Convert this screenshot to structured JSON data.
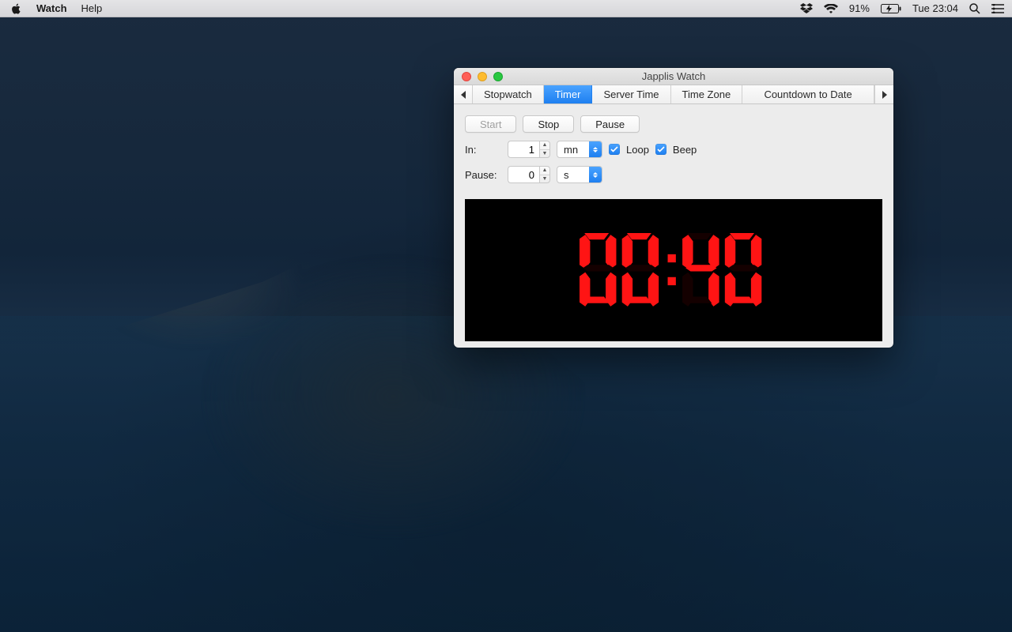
{
  "menubar": {
    "app": "Watch",
    "items": [
      "Help"
    ],
    "battery_pct": "91%",
    "clock": "Tue 23:04"
  },
  "window": {
    "title": "Japplis Watch",
    "tabs": [
      "Stopwatch",
      "Timer",
      "Server Time",
      "Time Zone",
      "Countdown to Date"
    ],
    "active_tab_index": 1,
    "buttons": {
      "start": "Start",
      "stop": "Stop",
      "pause": "Pause"
    },
    "in_label": "In:",
    "in_value": "1",
    "in_unit": "mn",
    "pause_label": "Pause:",
    "pause_value": "0",
    "pause_unit": "s",
    "loop_label": "Loop",
    "loop_checked": true,
    "beep_label": "Beep",
    "beep_checked": true,
    "display_time": "00:40"
  }
}
